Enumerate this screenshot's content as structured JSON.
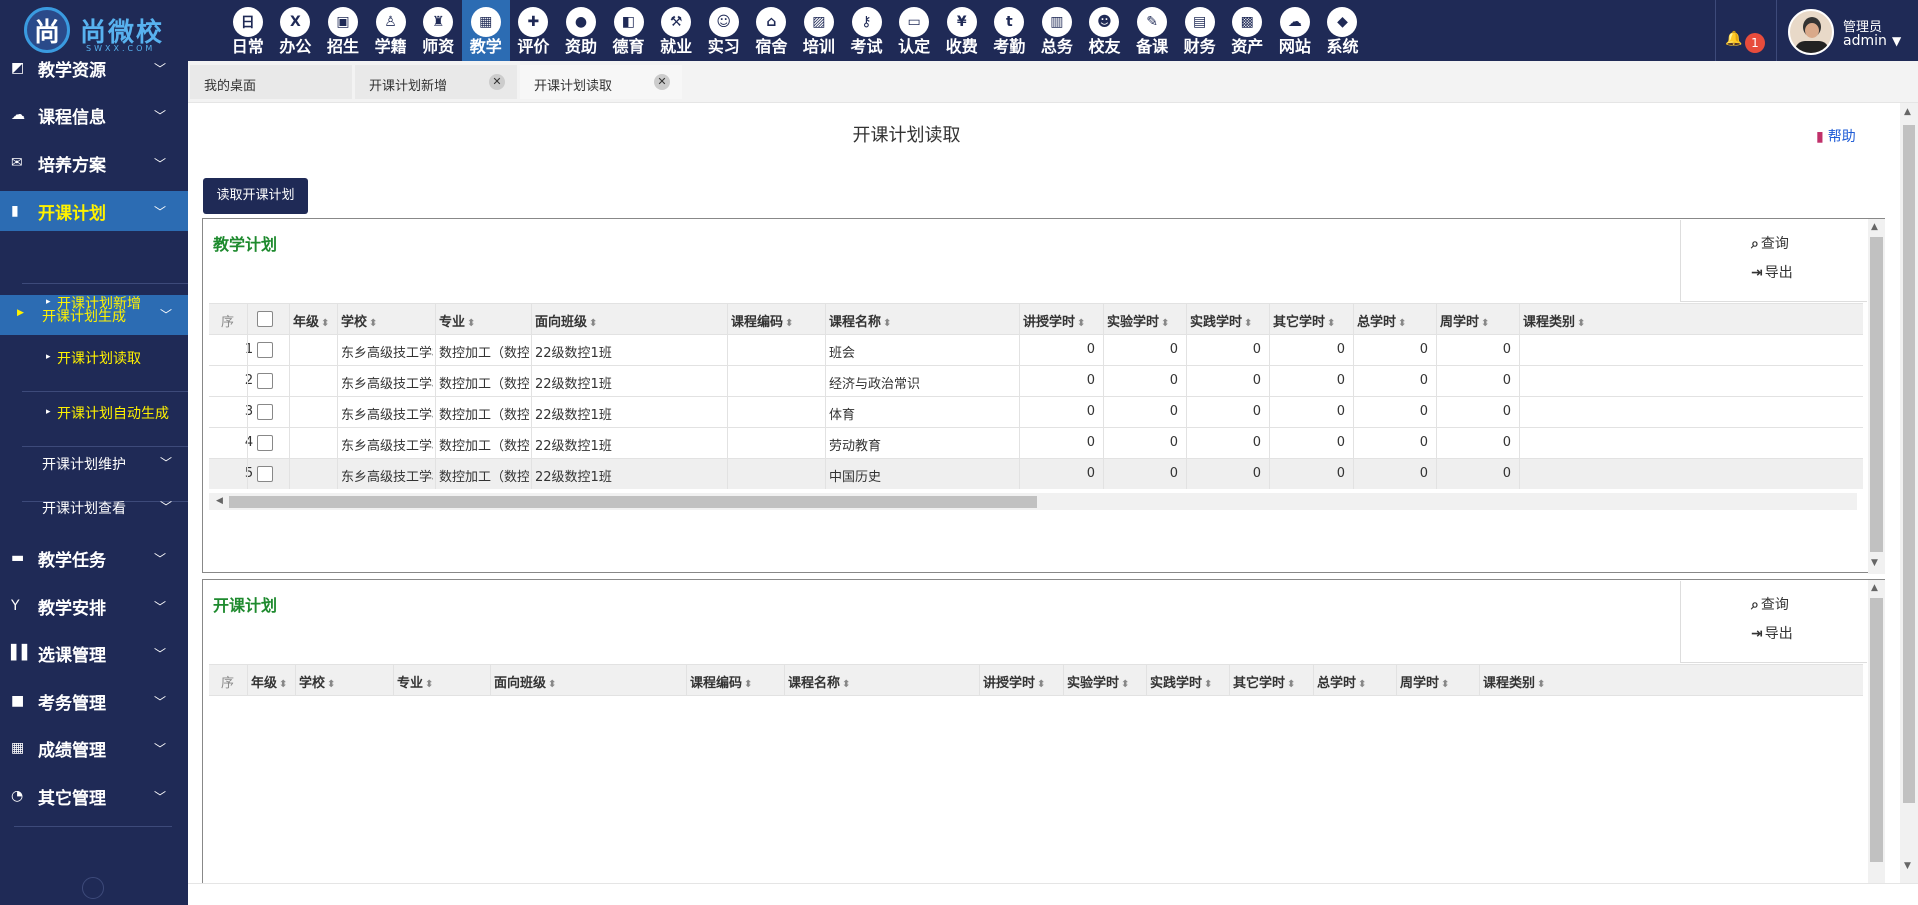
{
  "app": {
    "logo_text": "尚微校",
    "logo_sub": "SWXX.COM"
  },
  "modules": [
    {
      "label": "日常",
      "icon": "calendar-text-icon"
    },
    {
      "label": "办公",
      "icon": "office-icon"
    },
    {
      "label": "招生",
      "icon": "bus-icon"
    },
    {
      "label": "学籍",
      "icon": "student-icon"
    },
    {
      "label": "师资",
      "icon": "teacher-icon"
    },
    {
      "label": "教学",
      "icon": "calendar-grid-icon",
      "active": true
    },
    {
      "label": "评价",
      "icon": "evaluation-icon"
    },
    {
      "label": "资助",
      "icon": "aid-icon"
    },
    {
      "label": "德育",
      "icon": "book-icon"
    },
    {
      "label": "就业",
      "icon": "hammer-icon"
    },
    {
      "label": "实习",
      "icon": "robot-icon"
    },
    {
      "label": "宿舍",
      "icon": "house-icon"
    },
    {
      "label": "培训",
      "icon": "picture-icon"
    },
    {
      "label": "考试",
      "icon": "key-icon"
    },
    {
      "label": "认定",
      "icon": "monitor-icon"
    },
    {
      "label": "收费",
      "icon": "yen-icon"
    },
    {
      "label": "考勤",
      "icon": "t-icon"
    },
    {
      "label": "总务",
      "icon": "chart-icon"
    },
    {
      "label": "校友",
      "icon": "group-icon"
    },
    {
      "label": "备课",
      "icon": "edit-icon"
    },
    {
      "label": "财务",
      "icon": "newspaper-icon"
    },
    {
      "label": "资产",
      "icon": "train-icon"
    },
    {
      "label": "网站",
      "icon": "cloud-icon"
    },
    {
      "label": "系统",
      "icon": "cube-icon"
    }
  ],
  "header": {
    "notification_count": "1",
    "user_role": "管理员",
    "user_name": "admin"
  },
  "sidebar": {
    "items": [
      {
        "label": "教学资源"
      },
      {
        "label": "课程信息"
      },
      {
        "label": "培养方案"
      },
      {
        "label": "开课计划",
        "active": true
      },
      {
        "label": "教学任务"
      },
      {
        "label": "教学安排"
      },
      {
        "label": "选课管理"
      },
      {
        "label": "考务管理"
      },
      {
        "label": "成绩管理"
      },
      {
        "label": "其它管理"
      }
    ],
    "sub_group": "开课计划生成",
    "sub_items": [
      "开课计划新增",
      "开课计划读取",
      "开课计划自动生成"
    ],
    "other_groups": [
      "开课计划维护",
      "开课计划查看"
    ]
  },
  "tabs": [
    {
      "label": "我的桌面",
      "closable": false
    },
    {
      "label": "开课计划新增",
      "closable": true
    },
    {
      "label": "开课计划读取",
      "closable": true,
      "active": true
    }
  ],
  "page": {
    "title": "开课计划读取",
    "help_label": "帮助",
    "read_button": "读取开课计划"
  },
  "panel1": {
    "title": "教学计划",
    "query_label": "查询",
    "export_label": "导出",
    "columns": [
      "序",
      "年级",
      "学校",
      "专业",
      "面向班级",
      "课程编码",
      "课程名称",
      "讲授学时",
      "实验学时",
      "实践学时",
      "其它学时",
      "总学时",
      "周学时",
      "课程类别"
    ],
    "rows": [
      {
        "no": "1",
        "grade": "",
        "school": "东乡高级技工学校",
        "major": "数控加工（数控车",
        "class": "22级数控1班",
        "code": "",
        "course": "班会",
        "lecture": "0",
        "lab": "0",
        "practice": "0",
        "other": "0",
        "total": "0",
        "weekly": "0",
        "type": ""
      },
      {
        "no": "2",
        "grade": "",
        "school": "东乡高级技工学校",
        "major": "数控加工（数控车",
        "class": "22级数控1班",
        "code": "",
        "course": "经济与政治常识",
        "lecture": "0",
        "lab": "0",
        "practice": "0",
        "other": "0",
        "total": "0",
        "weekly": "0",
        "type": ""
      },
      {
        "no": "3",
        "grade": "",
        "school": "东乡高级技工学校",
        "major": "数控加工（数控车",
        "class": "22级数控1班",
        "code": "",
        "course": "体育",
        "lecture": "0",
        "lab": "0",
        "practice": "0",
        "other": "0",
        "total": "0",
        "weekly": "0",
        "type": ""
      },
      {
        "no": "4",
        "grade": "",
        "school": "东乡高级技工学校",
        "major": "数控加工（数控车",
        "class": "22级数控1班",
        "code": "",
        "course": "劳动教育",
        "lecture": "0",
        "lab": "0",
        "practice": "0",
        "other": "0",
        "total": "0",
        "weekly": "0",
        "type": ""
      },
      {
        "no": "5",
        "grade": "",
        "school": "东乡高级技工学校",
        "major": "数控加工（数控车",
        "class": "22级数控1班",
        "code": "",
        "course": "中国历史",
        "lecture": "0",
        "lab": "0",
        "practice": "0",
        "other": "0",
        "total": "0",
        "weekly": "0",
        "type": ""
      }
    ]
  },
  "panel2": {
    "title": "开课计划",
    "query_label": "查询",
    "export_label": "导出",
    "columns": [
      "序",
      "年级",
      "学校",
      "专业",
      "面向班级",
      "课程编码",
      "课程名称",
      "讲授学时",
      "实验学时",
      "实践学时",
      "其它学时",
      "总学时",
      "周学时",
      "课程类别"
    ]
  },
  "colors": {
    "primary": "#1f2a56",
    "active": "#2c6cb3",
    "highlight": "#fff200",
    "panel_title": "#1e8a2e",
    "help": "#1e5bd6"
  }
}
